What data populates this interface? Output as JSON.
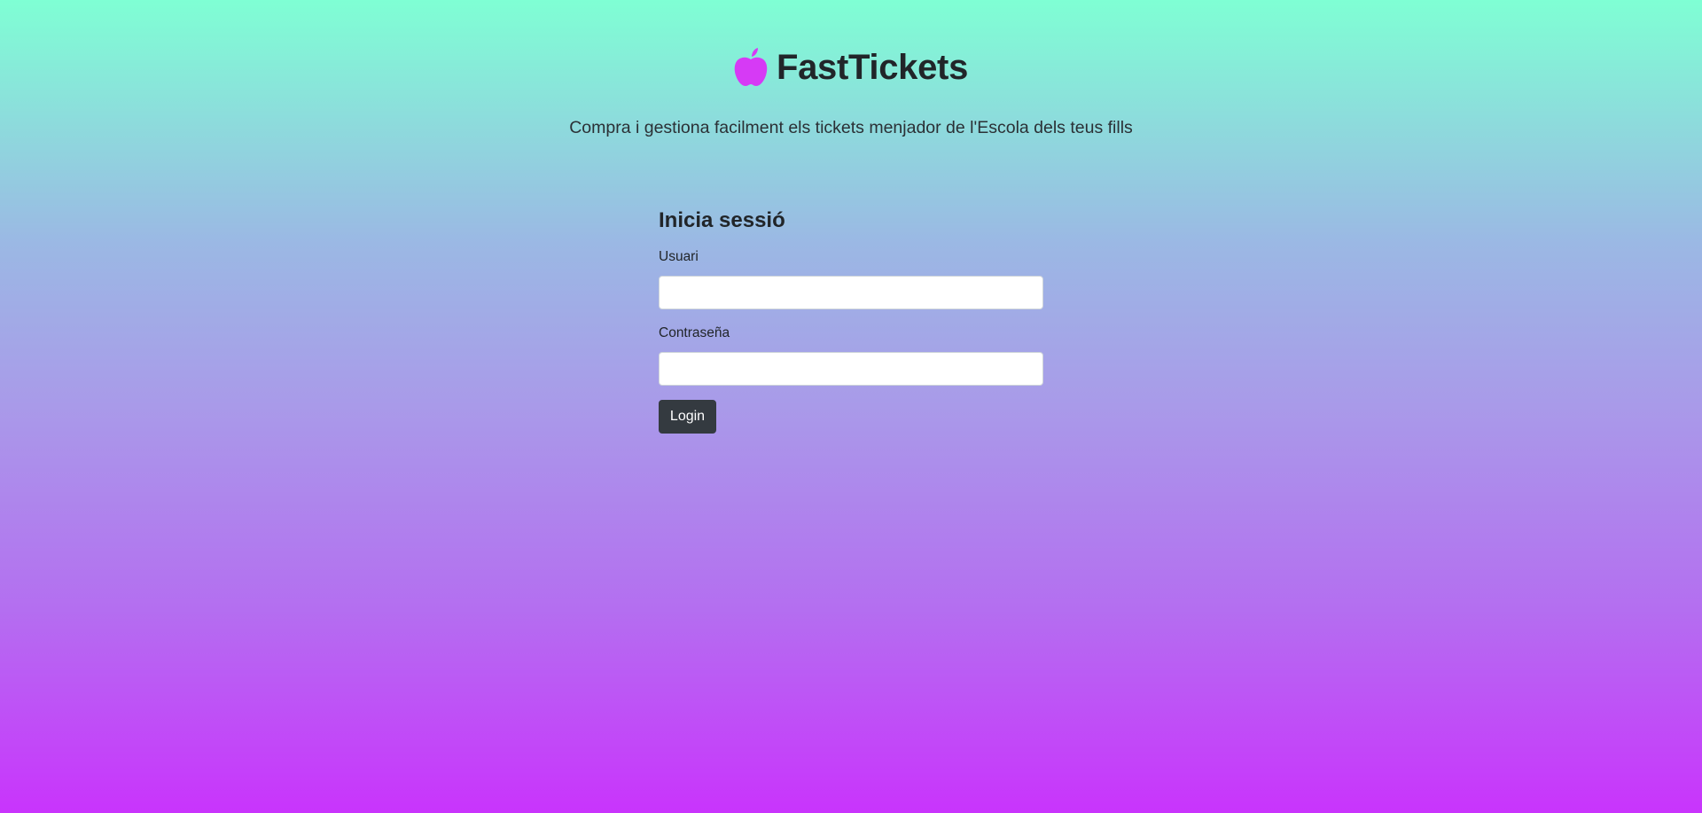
{
  "brand": {
    "icon": "apple-icon",
    "icon_color": "#d63af5",
    "title": "FastTickets"
  },
  "subtitle": "Compra i gestiona facilment els tickets menjador de l'Escola dels teus fills",
  "login_form": {
    "title": "Inicia sessió",
    "username_label": "Usuari",
    "username_value": "",
    "password_label": "Contraseña",
    "password_value": "",
    "submit_label": "Login"
  },
  "colors": {
    "gradient_top": "#7fffd4",
    "gradient_bottom": "#c934fc",
    "button": "#343a40"
  }
}
